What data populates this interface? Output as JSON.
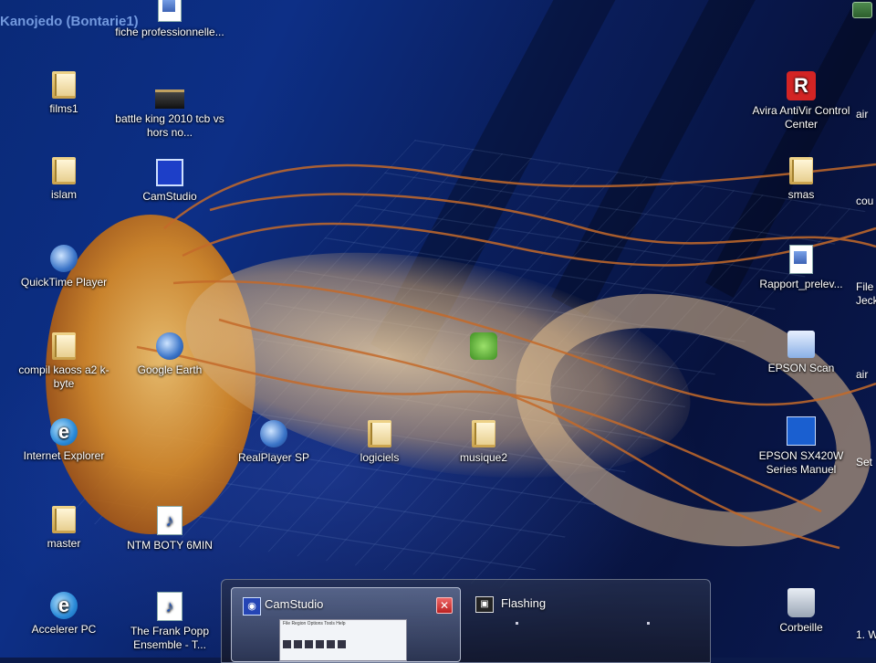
{
  "window_title": "Kanojedo (Bontarie1)",
  "desktop_icons": [
    {
      "label": "films1",
      "icon": "folder-icon"
    },
    {
      "label": "islam",
      "icon": "folder-icon"
    },
    {
      "label": "QuickTime Player",
      "icon": "quicktime-icon"
    },
    {
      "label": "compil kaoss a2 k-byte",
      "icon": "folder-icon"
    },
    {
      "label": "Internet Explorer",
      "icon": "internet-explorer-icon"
    },
    {
      "label": "master",
      "icon": "folder-icon"
    },
    {
      "label": "Accelerer PC",
      "icon": "internet-explorer-icon"
    },
    {
      "label": "fiche professionnelle...",
      "icon": "document-icon"
    },
    {
      "label": "battle king 2010 tcb vs hors no...",
      "icon": "video-file-icon"
    },
    {
      "label": "CamStudio",
      "icon": "camstudio-icon"
    },
    {
      "label": "Google Earth",
      "icon": "google-earth-icon"
    },
    {
      "label": "NTM BOTY 6MIN",
      "icon": "music-file-icon"
    },
    {
      "label": "The Frank Popp Ensemble - T...",
      "icon": "music-file-icon"
    },
    {
      "label": "RealPlayer SP",
      "icon": "realplayer-icon"
    },
    {
      "label": "logiciels",
      "icon": "folder-icon"
    },
    {
      "label": "musique2",
      "icon": "folder-icon"
    },
    {
      "label": "Avira AntiVir Control Center",
      "icon": "avira-icon"
    },
    {
      "label": "smas",
      "icon": "folder-icon"
    },
    {
      "label": "Rapport_prelev...",
      "icon": "word-document-icon"
    },
    {
      "label": "EPSON Scan",
      "icon": "scanner-icon"
    },
    {
      "label": "EPSON SX420W Series Manuel",
      "icon": "epson-manual-icon"
    },
    {
      "label": "Corbeille",
      "icon": "recycle-bin-icon"
    }
  ],
  "right_edge_labels": [
    "air",
    "cou",
    "File",
    "Jeck",
    "air",
    "Set",
    "1. W"
  ],
  "taskbar_preview": {
    "items": [
      {
        "title": "CamStudio",
        "active": true,
        "close_symbol": "✕"
      },
      {
        "title": "Flashing",
        "active": false
      }
    ],
    "mini_window_menu": "File Region Options Tools Help"
  },
  "colors": {
    "wallpaper_blue": "#0b1a4a",
    "jellyfish_orange": "#d98a25",
    "close_red": "#cc2222"
  }
}
